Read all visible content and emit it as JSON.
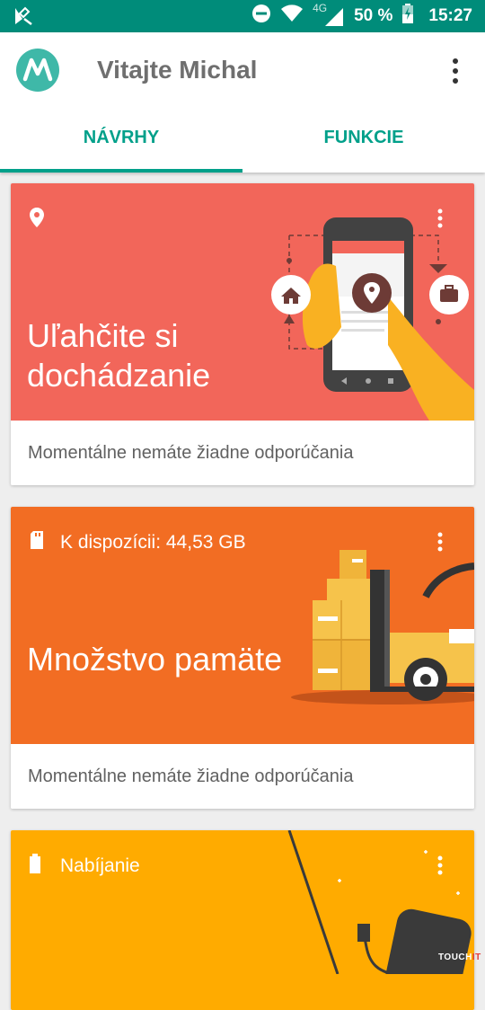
{
  "status_bar": {
    "battery": "50 %",
    "network": "4G",
    "time": "15:27"
  },
  "header": {
    "title": "Vitajte Michal"
  },
  "tabs": [
    {
      "label": "NÁVRHY",
      "selected": true
    },
    {
      "label": "FUNKCIE",
      "selected": false
    }
  ],
  "cards": [
    {
      "label": "",
      "title": "Uľahčite si dochádzanie",
      "footer": "Momentálne nemáte žiadne odporúčania",
      "icon": "location-pin-icon",
      "color": "#f2665a"
    },
    {
      "label": "K dispozícii: 44,53 GB",
      "title": "Množstvo pamäte",
      "footer": "Momentálne nemáte žiadne odporúčania",
      "icon": "sd-card-icon",
      "color": "#f26d23"
    },
    {
      "label": "Nabíjanie",
      "icon": "battery-icon",
      "color": "#ffab00"
    }
  ],
  "watermark": "TOUCHIT",
  "colors": {
    "accent": "#00a08a",
    "status_bar": "#008c7a"
  }
}
